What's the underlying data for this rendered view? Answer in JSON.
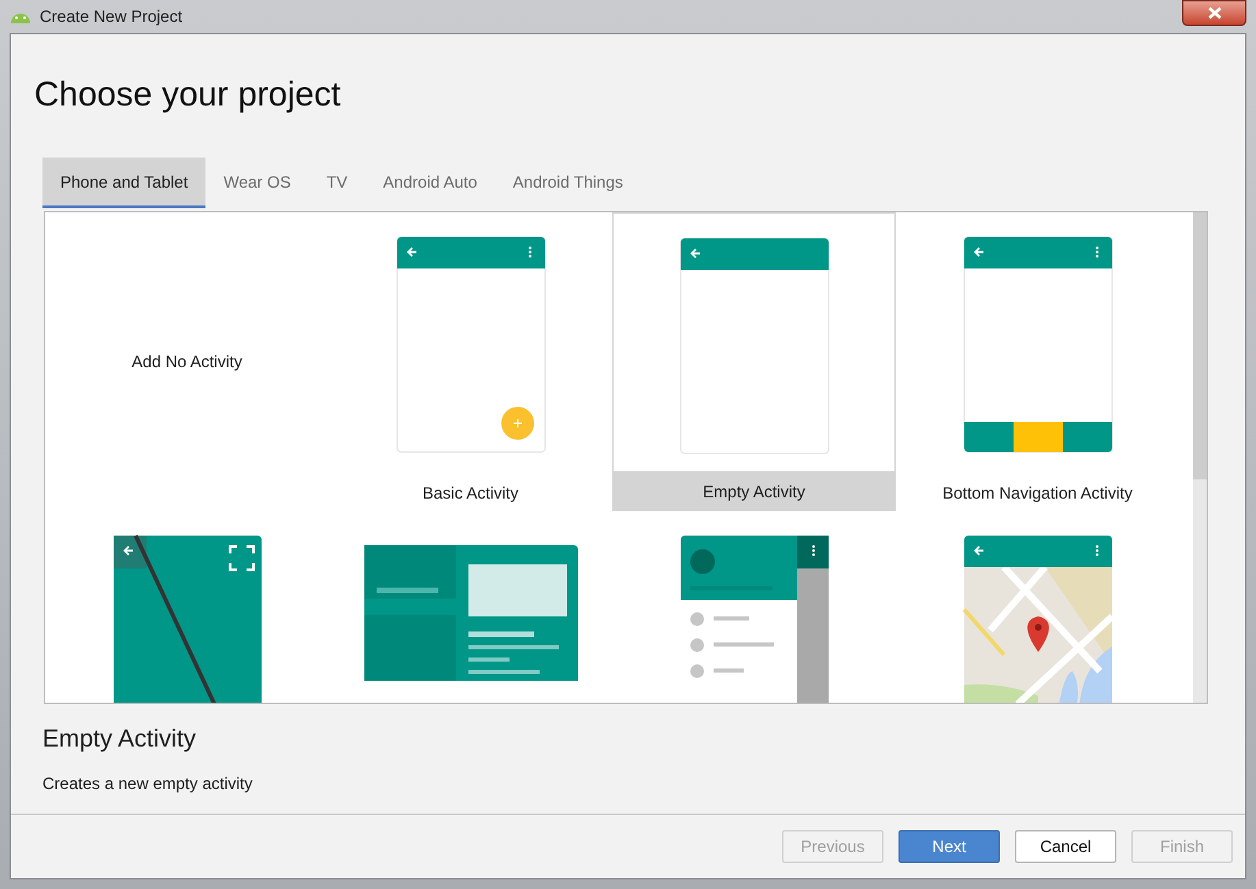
{
  "window": {
    "title": "Create New Project"
  },
  "heading": "Choose your project",
  "tabs": [
    {
      "label": "Phone and Tablet",
      "selected": true
    },
    {
      "label": "Wear OS",
      "selected": false
    },
    {
      "label": "TV",
      "selected": false
    },
    {
      "label": "Android Auto",
      "selected": false
    },
    {
      "label": "Android Things",
      "selected": false
    }
  ],
  "templates": [
    {
      "kind": "none",
      "label": "Add No Activity",
      "selected": false
    },
    {
      "kind": "basic",
      "label": "Basic Activity",
      "selected": false
    },
    {
      "kind": "empty",
      "label": "Empty Activity",
      "selected": true
    },
    {
      "kind": "bottom_nav",
      "label": "Bottom Navigation Activity",
      "selected": false
    },
    {
      "kind": "fullscreen",
      "selected": false
    },
    {
      "kind": "master_detail",
      "selected": false
    },
    {
      "kind": "nav_drawer",
      "selected": false
    },
    {
      "kind": "maps",
      "selected": false
    }
  ],
  "detail": {
    "title": "Empty Activity",
    "description": "Creates a new empty activity"
  },
  "buttons": [
    {
      "label": "Previous",
      "kind": "default",
      "disabled": true
    },
    {
      "label": "Next",
      "kind": "primary",
      "disabled": false
    },
    {
      "label": "Cancel",
      "kind": "default",
      "disabled": false
    },
    {
      "label": "Finish",
      "kind": "default",
      "disabled": true
    }
  ]
}
